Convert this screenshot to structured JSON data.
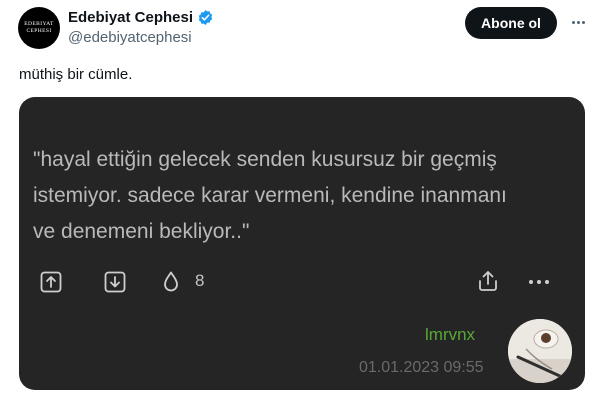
{
  "account": {
    "avatar_line1": "EDEBIYAT",
    "avatar_line2": "CEPHESI",
    "display_name": "Edebiyat Cephesi",
    "handle": "@edebiyatcephesi",
    "verified": true
  },
  "header": {
    "follow_label": "Abone ol",
    "more_icon": "more-horizontal-icon"
  },
  "tweet": {
    "text": "müthiş bir cümle."
  },
  "media": {
    "quote_lines": [
      "\"hayal ettiğin gelecek senden kusursuz bir geçmiş",
      "istemiyor. sadece karar vermeni, kendine inanmanı",
      "ve denemeni bekliyor..\""
    ],
    "like_count": "8",
    "author": "lmrvnx",
    "timestamp": "01.01.2023 09:55",
    "icons": [
      "share-box-icon",
      "save-box-icon",
      "drop-icon",
      "upload-icon",
      "more-horizontal-icon"
    ]
  },
  "colors": {
    "follow_bg": "#0f1419",
    "verified": "#1d9bf0",
    "media_bg": "#252525",
    "quote_text": "#b9b9b9",
    "author": "#58a838"
  }
}
